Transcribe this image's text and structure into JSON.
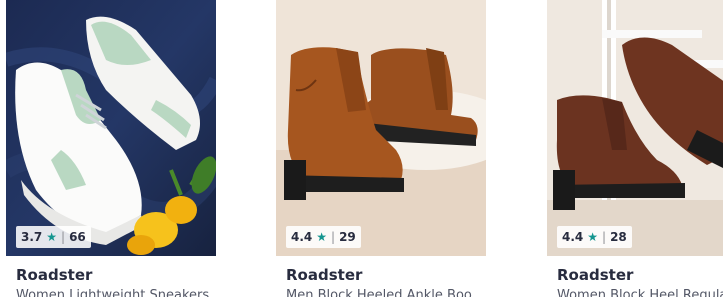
{
  "products": [
    {
      "rating": "3.7",
      "rating_count": "66",
      "separator": "|",
      "brand": "Roadster",
      "name": "Women Lightweight Sneakers"
    },
    {
      "rating": "4.4",
      "rating_count": "29",
      "separator": "|",
      "brand": "Roadster",
      "name": "Men Block Heeled Ankle Boo"
    },
    {
      "rating": "4.4",
      "rating_count": "28",
      "separator": "|",
      "brand": "Roadster",
      "name": "Women Block Heel Regular"
    }
  ],
  "colors": {
    "star": "#14958f",
    "text_primary": "#282c3f",
    "text_secondary": "#535766"
  },
  "icons": {
    "rating_star": "★"
  }
}
